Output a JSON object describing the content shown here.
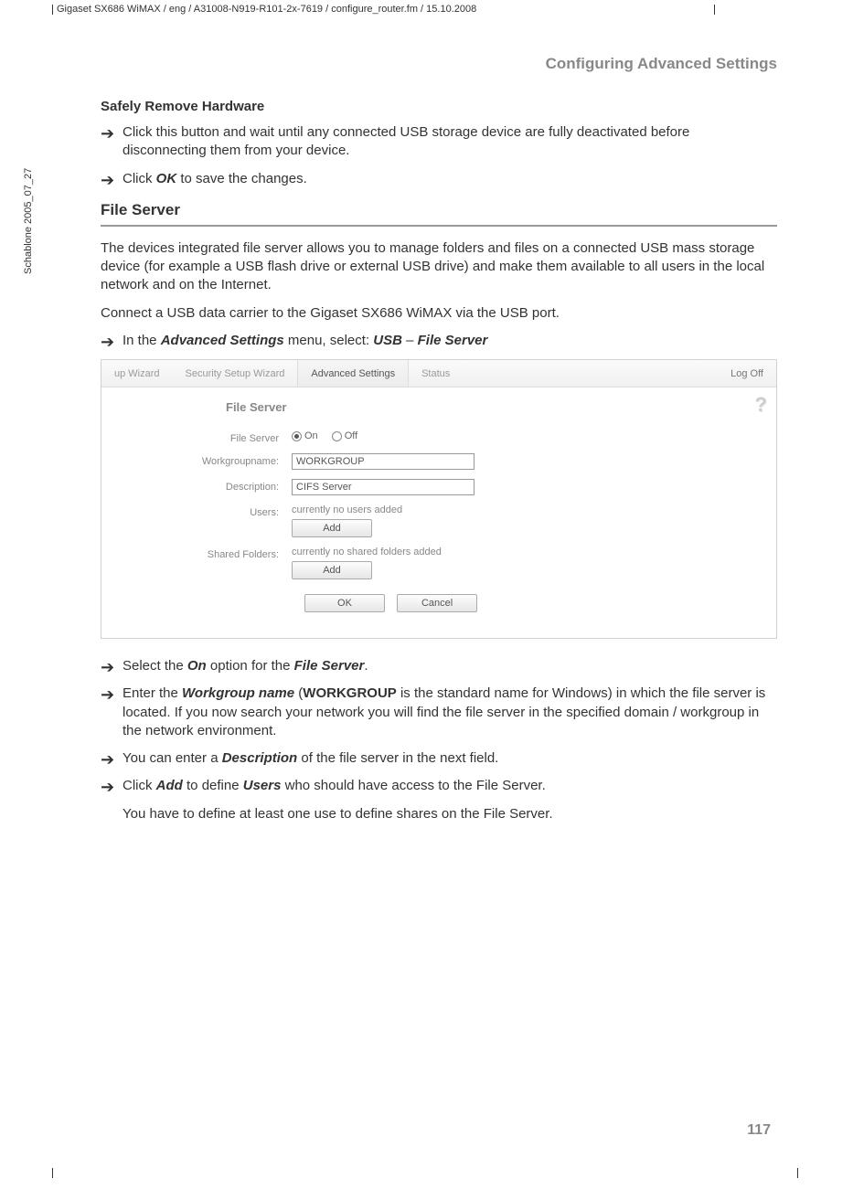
{
  "doc_header": "Gigaset SX686 WiMAX / eng / A31008-N919-R101-2x-7619 / configure_router.fm / 15.10.2008",
  "sidebar_text": "Schablone 2005_07_27",
  "section_title": "Configuring Advanced Settings",
  "safely_remove": {
    "heading": "Safely Remove Hardware",
    "step1": "Click this button and wait until any connected USB storage device are fully deactivated before disconnecting them from your device.",
    "step2_pre": "Click ",
    "step2_bold": "OK",
    "step2_post": " to save the changes."
  },
  "file_server": {
    "heading": "File Server",
    "para1": "The devices integrated file server allows you to manage folders and files on a connected USB mass storage device (for example a USB flash drive or external USB drive) and make them available to all users in the local network and on the Internet.",
    "para2": "Connect a USB data carrier to the Gigaset SX686 WiMAX via the USB port.",
    "menu_pre": "In the ",
    "menu_b1": "Advanced Settings",
    "menu_mid": " menu, select: ",
    "menu_b2": "USB",
    "menu_dash": " – ",
    "menu_b3": "File Server"
  },
  "ss": {
    "tabs": {
      "t1": "up Wizard",
      "t2": "Security Setup Wizard",
      "t3": "Advanced Settings",
      "t4": "Status",
      "logoff": "Log Off"
    },
    "title": "File Server",
    "labels": {
      "fs": "File Server",
      "wg": "Workgroupname:",
      "desc": "Description:",
      "users": "Users:",
      "shared": "Shared Folders:"
    },
    "radio_on": "On",
    "radio_off": "Off",
    "wg_value": "WORKGROUP",
    "desc_value": "CIFS Server",
    "users_status": "currently no users added",
    "shared_status": "currently no shared folders added",
    "btn_add": "Add",
    "btn_ok": "OK",
    "btn_cancel": "Cancel"
  },
  "after": {
    "s1_pre": "Select the ",
    "s1_b1": "On",
    "s1_mid": " option for the ",
    "s1_b2": "File Server",
    "s1_post": ".",
    "s2_pre": "Enter the ",
    "s2_b1": "Workgroup name",
    "s2_mid1": " (",
    "s2_b2": "WORKGROUP",
    "s2_post": " is the standard name for Windows) in which the file server is located. If you now search your network you will find the file server in the specified domain / workgroup in the network environment.",
    "s3_pre": "You can enter a ",
    "s3_b1": "Description",
    "s3_post": " of the file server in the next field.",
    "s4_pre": "Click ",
    "s4_b1": "Add",
    "s4_mid": " to define ",
    "s4_b2": "Users",
    "s4_post": " who should have access to the File Server.",
    "s4_note_pre": "You have to define at least one use to define shares on the ",
    "s4_note_b": "File Server",
    "s4_note_post": "."
  },
  "page_number": "117"
}
